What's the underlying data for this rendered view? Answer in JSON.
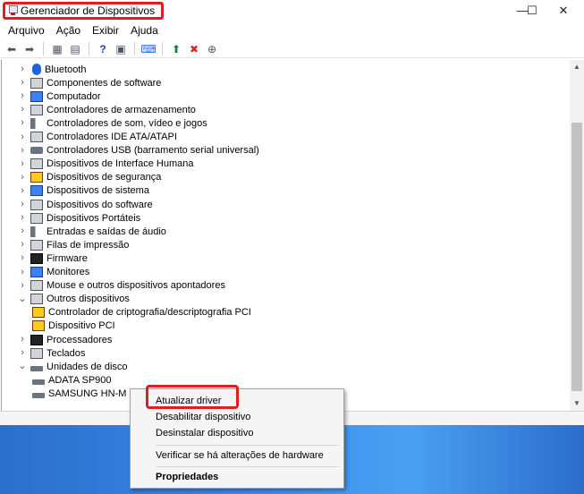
{
  "window": {
    "title": "Gerenciador de Dispositivos",
    "controls": {
      "minimize": "—",
      "maximize": "☐",
      "close": "✕"
    }
  },
  "menu": {
    "items": [
      "Arquivo",
      "Ação",
      "Exibir",
      "Ajuda"
    ]
  },
  "toolbar": {
    "buttons": [
      "back-icon",
      "forward-icon",
      "properties-grid-icon",
      "view-list-icon",
      "help-icon",
      "details-icon",
      "monitor-scan-icon",
      "add-driver-icon",
      "uninstall-x-icon",
      "update-driver-icon"
    ],
    "symbols": {
      "back": "⬅",
      "forward": "➡",
      "props": "▦",
      "list": "▤",
      "help": "?",
      "details": "▣",
      "scan": "⌨",
      "add": "⬆",
      "remove": "✖",
      "update": "⊕"
    }
  },
  "tree": {
    "chev_collapsed": "›",
    "chev_expanded": "⌄",
    "items": [
      {
        "label": "Bluetooth",
        "expanded": false,
        "icon": "bluetooth-icon",
        "indent": 0
      },
      {
        "label": "Componentes de software",
        "expanded": false,
        "icon": "software-component-icon",
        "indent": 0
      },
      {
        "label": "Computador",
        "expanded": false,
        "icon": "computer-icon",
        "indent": 0
      },
      {
        "label": "Controladores de armazenamento",
        "expanded": false,
        "icon": "storage-controller-icon",
        "indent": 0
      },
      {
        "label": "Controladores de som, vídeo e jogos",
        "expanded": false,
        "icon": "speaker-icon",
        "indent": 0
      },
      {
        "label": "Controladores IDE ATA/ATAPI",
        "expanded": false,
        "icon": "ide-icon",
        "indent": 0
      },
      {
        "label": "Controladores USB (barramento serial universal)",
        "expanded": false,
        "icon": "usb-icon",
        "indent": 0
      },
      {
        "label": "Dispositivos de Interface Humana",
        "expanded": false,
        "icon": "hid-icon",
        "indent": 0
      },
      {
        "label": "Dispositivos de segurança",
        "expanded": false,
        "icon": "security-key-icon",
        "indent": 0
      },
      {
        "label": "Dispositivos de sistema",
        "expanded": false,
        "icon": "system-device-icon",
        "indent": 0
      },
      {
        "label": "Dispositivos do software",
        "expanded": false,
        "icon": "software-device-icon",
        "indent": 0
      },
      {
        "label": "Dispositivos Portáteis",
        "expanded": false,
        "icon": "portable-device-icon",
        "indent": 0
      },
      {
        "label": "Entradas e saídas de áudio",
        "expanded": false,
        "icon": "audio-io-icon",
        "indent": 0
      },
      {
        "label": "Filas de impressão",
        "expanded": false,
        "icon": "printer-icon",
        "indent": 0
      },
      {
        "label": "Firmware",
        "expanded": false,
        "icon": "firmware-icon",
        "indent": 0
      },
      {
        "label": "Monitores",
        "expanded": false,
        "icon": "monitor-icon",
        "indent": 0
      },
      {
        "label": "Mouse e outros dispositivos apontadores",
        "expanded": false,
        "icon": "mouse-icon",
        "indent": 0
      },
      {
        "label": "Outros dispositivos",
        "expanded": true,
        "icon": "other-devices-icon",
        "indent": 0
      },
      {
        "label": "Controlador de criptografia/descriptografia PCI",
        "expanded": null,
        "icon": "warning-device-icon",
        "indent": 1
      },
      {
        "label": "Dispositivo PCI",
        "expanded": null,
        "icon": "warning-device-icon",
        "indent": 1
      },
      {
        "label": "Processadores",
        "expanded": false,
        "icon": "processor-icon",
        "indent": 0
      },
      {
        "label": "Teclados",
        "expanded": false,
        "icon": "keyboard-icon",
        "indent": 0
      },
      {
        "label": "Unidades de disco",
        "expanded": true,
        "icon": "disk-drive-icon",
        "indent": 0
      },
      {
        "label": "ADATA SP900",
        "expanded": null,
        "icon": "disk-drive-icon",
        "indent": 1
      },
      {
        "label": "SAMSUNG HN-M",
        "expanded": null,
        "icon": "disk-drive-icon",
        "indent": 1
      }
    ]
  },
  "context_menu": {
    "items": [
      {
        "label": "Atualizar driver",
        "bold": false
      },
      {
        "label": "Desabilitar dispositivo",
        "bold": false
      },
      {
        "label": "Desinstalar dispositivo",
        "bold": false
      },
      {
        "label": "Verificar se há alterações de hardware",
        "bold": false
      },
      {
        "label": "Propriedades",
        "bold": true
      }
    ]
  },
  "scroll": {
    "up": "▲",
    "down": "▼"
  },
  "colors": {
    "highlight": "#e11d1d",
    "desktop": "#3c8bea"
  }
}
